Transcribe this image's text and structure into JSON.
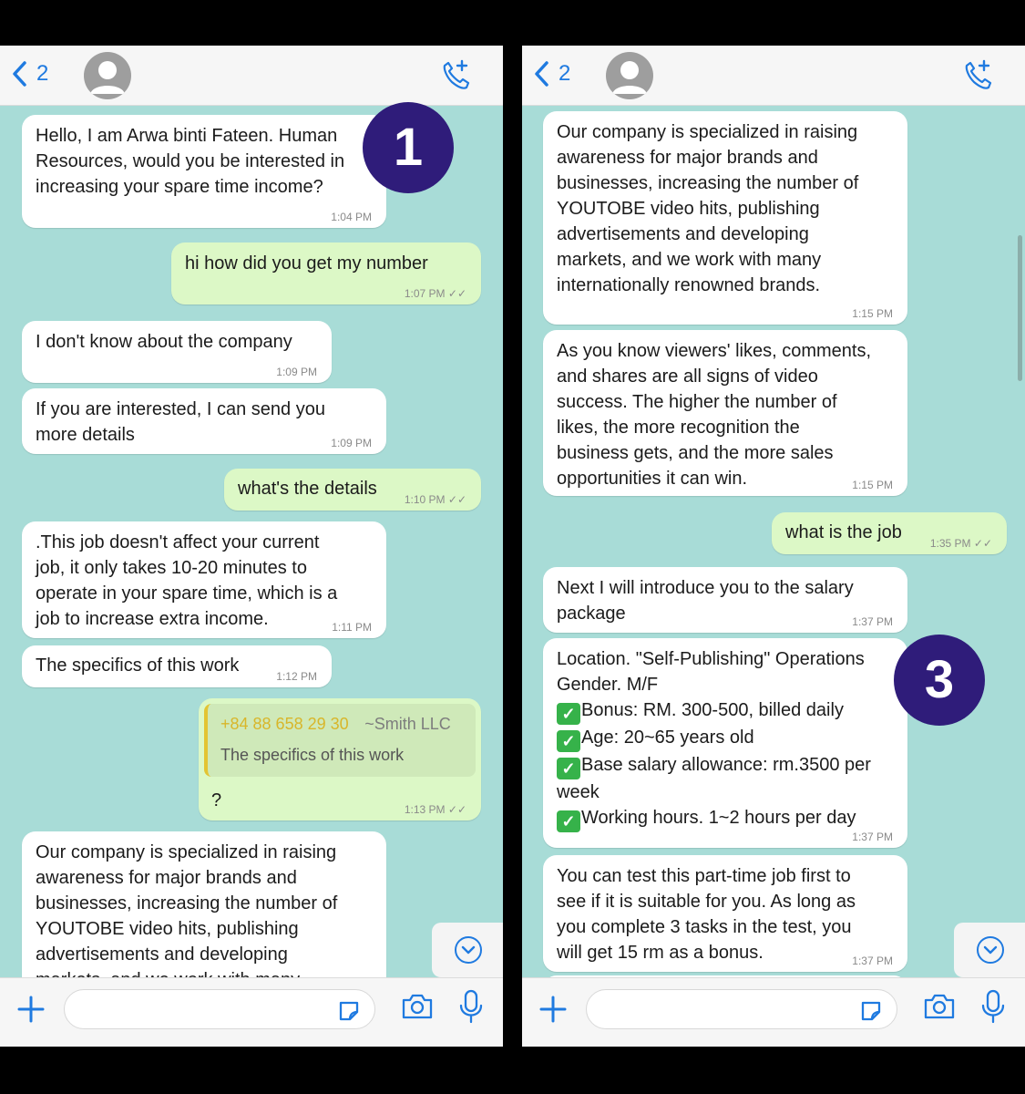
{
  "left": {
    "header": {
      "back_count": "2"
    },
    "badge": "1",
    "messages": [
      {
        "dir": "in",
        "text": "Hello,  I am Arwa binti Fateen. Human\nResources, would you be interested in\nincreasing your spare time income?",
        "time": "1:04 PM"
      },
      {
        "dir": "out",
        "text": "hi how did you get my number",
        "time": "1:07 PM"
      },
      {
        "dir": "in",
        "text": "I don't know about the company",
        "time": "1:09 PM"
      },
      {
        "dir": "in",
        "text": "If you are interested, I can send you\nmore details",
        "time": "1:09 PM"
      },
      {
        "dir": "out",
        "text": "what's the details",
        "time": "1:10 PM"
      },
      {
        "dir": "in",
        "text": ".This job doesn't affect your current\njob,  it only takes 10-20 minutes to\noperate in your spare time, which is a\njob to increase extra income.",
        "time": "1:11 PM"
      },
      {
        "dir": "in",
        "text": "The specifics of this work",
        "time": "1:12 PM"
      },
      {
        "dir": "out",
        "text": "?",
        "time": "1:13 PM",
        "quote": {
          "phone": "+84 88 658 29 30",
          "name": "~Smith LLC",
          "text": "The specifics of this work"
        }
      },
      {
        "dir": "in",
        "text": "Our company is specialized in raising\nawareness for major brands and\nbusinesses, increasing the number of\nYOUTOBE video hits, publishing\nadvertisements and developing\nmarkets, and we work with many",
        "time": ""
      }
    ]
  },
  "right": {
    "header": {
      "back_count": "2"
    },
    "badge": "3",
    "messages": [
      {
        "dir": "in",
        "text": "Our company is specialized in raising\nawareness for major brands and\nbusinesses, increasing the number of\nYOUTOBE video hits, publishing\nadvertisements and developing\nmarkets, and we work with many\ninternationally renowned brands.",
        "time": "1:15 PM"
      },
      {
        "dir": "in",
        "text": "As you know viewers' likes, comments,\nand shares are all signs of video\nsuccess. The higher the number of\nlikes, the more recognition the\nbusiness gets, and the more sales\nopportunities it can win.",
        "time": "1:15 PM"
      },
      {
        "dir": "out",
        "text": "what is the job",
        "time": "1:35 PM"
      },
      {
        "dir": "in",
        "text": "Next I will introduce you to the salary\npackage",
        "time": "1:37 PM"
      },
      {
        "dir": "in",
        "text": "",
        "time": "1:37 PM",
        "lines": [
          {
            "check": false,
            "text": "Location. \"Self-Publishing\" Operations"
          },
          {
            "check": false,
            "text": "Gender. M/F"
          },
          {
            "check": true,
            "text": "Bonus: RM. 300-500, billed daily"
          },
          {
            "check": true,
            "text": "Age: 20~65 years old"
          },
          {
            "check": true,
            "text": "Base salary allowance: rm.3500 per"
          },
          {
            "check": false,
            "text": "week"
          },
          {
            "check": true,
            "text": "Working hours. 1~2 hours per day"
          }
        ]
      },
      {
        "dir": "in",
        "text": "You can test this part-time job first to\nsee if it is suitable for you. As long as\nyou complete 3 tasks in the test, you\nwill get 15 rm as a bonus.",
        "time": "1:37 PM"
      }
    ]
  },
  "colors": {
    "incoming": "#ffffff",
    "outgoing": "#dcf8c6",
    "wallpaper": "#a8dcd7",
    "accent": "#1f7ae0",
    "badge": "#2f1c7a"
  },
  "icons": [
    "back-chevron-icon",
    "avatar-icon",
    "add-call-icon",
    "chevron-down-icon",
    "plus-icon",
    "sticker-icon",
    "camera-icon",
    "mic-icon"
  ]
}
